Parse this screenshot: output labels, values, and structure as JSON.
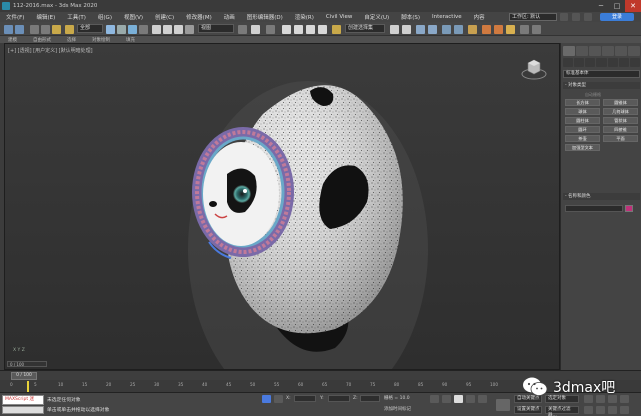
{
  "window": {
    "title": "112-2016.max - 3ds Max 2020",
    "minimize": "─",
    "maximize": "□",
    "close": "✕"
  },
  "menu": {
    "items": [
      "文件(F)",
      "编辑(E)",
      "工具(T)",
      "组(G)",
      "视图(V)",
      "创建(C)",
      "修改器(M)",
      "动画",
      "图形编辑器(D)",
      "渲染(R)",
      "Civil View",
      "自定义(U)",
      "脚本(S)",
      "Interactive",
      "内容"
    ],
    "workspace": "工作区: 默认",
    "login": "登录"
  },
  "toolbar": {
    "filter_all": "全部",
    "view_select": "视图",
    "selection_set": "创建选择集"
  },
  "ribbon": {
    "tabs": [
      "建模",
      "自由形式",
      "选择",
      "对象绘制",
      "填充"
    ]
  },
  "viewport": {
    "label": "[+] [透视] [用户定义] [默认明暗处理]",
    "corner_text": "X  Y  Z",
    "status_chip": "0 / 100"
  },
  "command_panel": {
    "category_dropdown": "标准基本体",
    "rollout_object_type": "- 对象类型",
    "autogrid_note": "自动栅格",
    "buttons": [
      "长方体",
      "圆锥体",
      "球体",
      "几何球体",
      "圆柱体",
      "管状体",
      "圆环",
      "四棱锥",
      "茶壶",
      "平面",
      "加强型文本"
    ],
    "rollout_name_color": "- 名称和颜色",
    "accent_color": "#c0317a"
  },
  "timeline": {
    "thumb": "0 / 100",
    "ticks": [
      "0",
      "5",
      "10",
      "15",
      "20",
      "25",
      "30",
      "35",
      "40",
      "45",
      "50",
      "55",
      "60",
      "65",
      "70",
      "75",
      "80",
      "85",
      "90",
      "95",
      "100"
    ]
  },
  "statusbar": {
    "script_label": "MAXScript 迷",
    "status_line1": "未选定任何对象",
    "status_line2": "单击或单击并拖动以选择对象",
    "x_label": "X:",
    "y_label": "Y:",
    "z_label": "Z:",
    "grid": "栅格 = 10.0",
    "add_time_tag": "添加时间标记",
    "auto_key": "自动关键点",
    "set_key": "设置关键点",
    "selected": "选定对象",
    "key_filter": "关键点过滤器..."
  },
  "watermark": {
    "text": "3dmax吧"
  }
}
